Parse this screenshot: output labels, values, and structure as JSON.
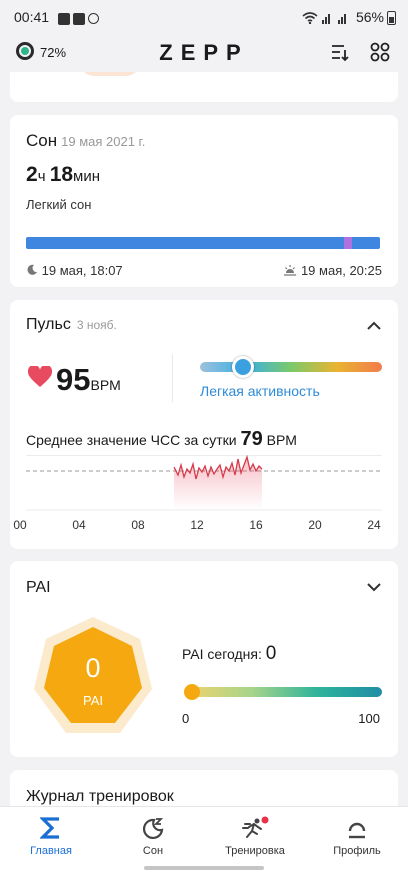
{
  "status_bar": {
    "time": "00:41",
    "battery": "56%"
  },
  "header": {
    "watch_battery": "72%",
    "logo": "ZEPP"
  },
  "sleep": {
    "title": "Сон",
    "date": "19 мая 2021 г.",
    "hours": "2",
    "hours_unit": "ч",
    "minutes": "18",
    "minutes_unit": "мин",
    "type": "Легкий сон",
    "start": "19 мая, 18:07",
    "end": "19 мая, 20:25"
  },
  "pulse": {
    "title": "Пульс",
    "date": "3 нояб.",
    "value": "95",
    "unit": "BPM",
    "zone": "Легкая активность",
    "zone_level": 0.2,
    "avg_label": "Среднее значение ЧСС за сутки",
    "avg_value": "79",
    "avg_unit": "BPM",
    "ticks": [
      "00",
      "04",
      "08",
      "12",
      "16",
      "20",
      "24"
    ]
  },
  "pai": {
    "title": "PAI",
    "value": "0",
    "label": "PAI",
    "today_label": "PAI сегодня:",
    "today_value": "0",
    "scale_min": "0",
    "scale_max": "100",
    "hex_color": "#f5a80f"
  },
  "journal": {
    "title": "Журнал тренировок"
  },
  "nav": {
    "items": [
      {
        "label": "Главная"
      },
      {
        "label": "Сон"
      },
      {
        "label": "Тренировка"
      },
      {
        "label": "Профиль"
      }
    ]
  },
  "colors": {
    "accent": "#1a6fd4",
    "heart": "#e84a5f",
    "sleep_bar": "#3f86e0",
    "rem": "#b071e0"
  }
}
